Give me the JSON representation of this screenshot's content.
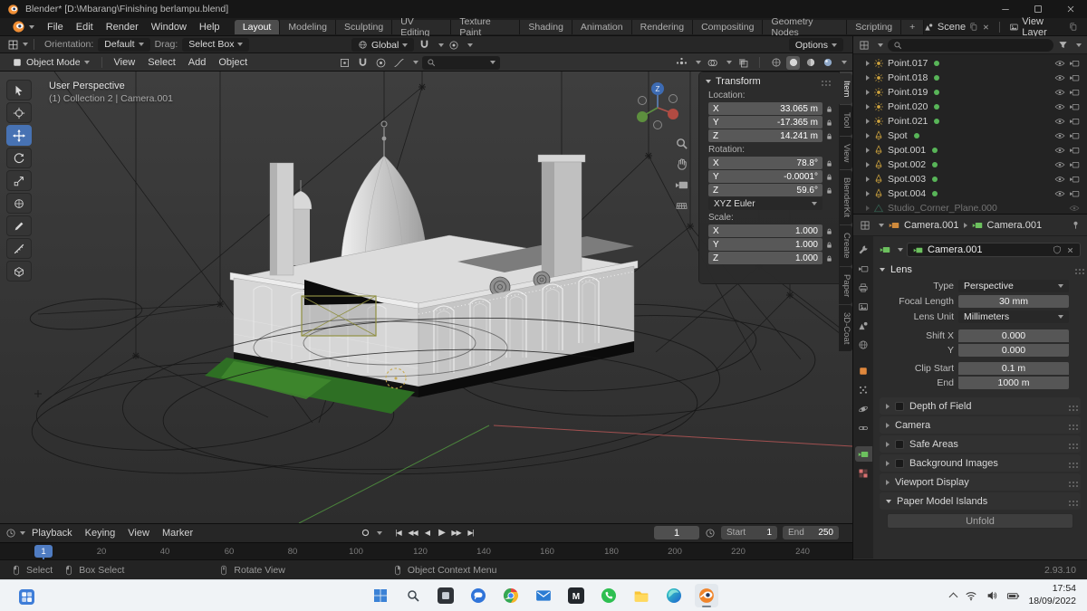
{
  "titlebar": {
    "title": "Blender* [D:\\Mbarang\\Finishing berlampu.blend]"
  },
  "menubar": {
    "menus": [
      "File",
      "Edit",
      "Render",
      "Window",
      "Help"
    ],
    "workspaces": [
      "Layout",
      "Modeling",
      "Sculpting",
      "UV Editing",
      "Texture Paint",
      "Shading",
      "Animation",
      "Rendering",
      "Compositing",
      "Geometry Nodes",
      "Scripting"
    ],
    "add_workspace": "+",
    "scene_name": "Scene",
    "view_layer_name": "View Layer"
  },
  "tool_settings": {
    "orientation_label": "Orientation:",
    "orientation_value": "Default",
    "drag_label": "Drag:",
    "drag_value": "Select Box",
    "transform_space": "Global",
    "options": "Options"
  },
  "viewport": {
    "mode": "Object Mode",
    "menus": [
      "View",
      "Select",
      "Add",
      "Object"
    ],
    "overlay": {
      "line1": "User Perspective",
      "line2": "(1) Collection 2 | Camera.001"
    }
  },
  "sidebar_tabs": [
    "Item",
    "Tool",
    "View",
    "BlenderKit",
    "Create",
    "Paper",
    "3D-Coat"
  ],
  "transform": {
    "title": "Transform",
    "axes": [
      "X",
      "Y",
      "Z"
    ],
    "location_label": "Location:",
    "location": {
      "x": "33.065 m",
      "y": "-17.365 m",
      "z": "14.241 m"
    },
    "rotation_label": "Rotation:",
    "rotation": {
      "x": "78.8°",
      "y": "-0.0001°",
      "z": "59.6°"
    },
    "rotation_mode": "XYZ Euler",
    "scale_label": "Scale:",
    "scale": {
      "x": "1.000",
      "y": "1.000",
      "z": "1.000"
    }
  },
  "outliner": {
    "items": [
      {
        "name": "Point.017",
        "type": "point-light"
      },
      {
        "name": "Point.018",
        "type": "point-light"
      },
      {
        "name": "Point.019",
        "type": "point-light"
      },
      {
        "name": "Point.020",
        "type": "point-light"
      },
      {
        "name": "Point.021",
        "type": "point-light"
      },
      {
        "name": "Spot",
        "type": "spot-light"
      },
      {
        "name": "Spot.001",
        "type": "spot-light"
      },
      {
        "name": "Spot.002",
        "type": "spot-light"
      },
      {
        "name": "Spot.003",
        "type": "spot-light"
      },
      {
        "name": "Spot.004",
        "type": "spot-light"
      },
      {
        "name": "Studio_Corner_Plane.000",
        "type": "mesh"
      }
    ]
  },
  "properties": {
    "breadcrumb": {
      "object": "Camera.001",
      "data": "Camera.001"
    },
    "name_field": "Camera.001",
    "lens": {
      "title": "Lens",
      "type_label": "Type",
      "type_value": "Perspective",
      "focal_label": "Focal Length",
      "focal_value": "30 mm",
      "unit_label": "Lens Unit",
      "unit_value": "Millimeters",
      "shift_x_label": "Shift X",
      "shift_x_value": "0.000",
      "shift_y_label": "Y",
      "shift_y_value": "0.000",
      "clip_start_label": "Clip Start",
      "clip_start_value": "0.1 m",
      "clip_end_label": "End",
      "clip_end_value": "1000 m"
    },
    "sections": [
      {
        "label": "Depth of Field",
        "has_checkbox": true
      },
      {
        "label": "Camera",
        "has_checkbox": false
      },
      {
        "label": "Safe Areas",
        "has_checkbox": true
      },
      {
        "label": "Background Images",
        "has_checkbox": true
      },
      {
        "label": "Viewport Display",
        "has_checkbox": false
      },
      {
        "label": "Paper Model Islands",
        "has_checkbox": false
      }
    ],
    "unfold_button": "Unfold"
  },
  "timeline": {
    "menus": [
      "Playback",
      "Keying",
      "View",
      "Marker"
    ],
    "controls": {
      "jump_start": "|◀",
      "key_prev": "◀◀",
      "play_reverse": "◀",
      "play": "▶",
      "key_next": "▶▶",
      "jump_end": "▶|"
    },
    "current_frame": "1",
    "start_label": "Start",
    "start_value": "1",
    "end_label": "End",
    "end_value": "250",
    "ticks": [
      "20",
      "40",
      "60",
      "80",
      "100",
      "120",
      "140",
      "160",
      "180",
      "200",
      "220",
      "240"
    ]
  },
  "statusbar": {
    "hints": [
      "Select",
      "Box Select",
      "Rotate View",
      "Object Context Menu"
    ],
    "version": "2.93.10"
  },
  "taskbar": {
    "time": "17:54",
    "date": "18/09/2022"
  },
  "icons": {
    "blender-logo": "orange blender disc",
    "chevron-down-icon": "css triangle",
    "search-icon": "magnifier",
    "magnet-icon": "snap magnet",
    "eye-icon": "visibility eye",
    "camera-icon": "camera",
    "lock-icon": "padlock",
    "funnel-icon": "filter funnel",
    "pin-icon": "pin",
    "clock-icon": "clock",
    "mouse-left-icon": "LMB",
    "mouse-middle-icon": "MMB",
    "mouse-right-icon": "RMB",
    "wifi-icon": "wifi arcs",
    "volume-icon": "speaker",
    "battery-icon": "battery",
    "chevron-up-icon": "tray expander"
  }
}
